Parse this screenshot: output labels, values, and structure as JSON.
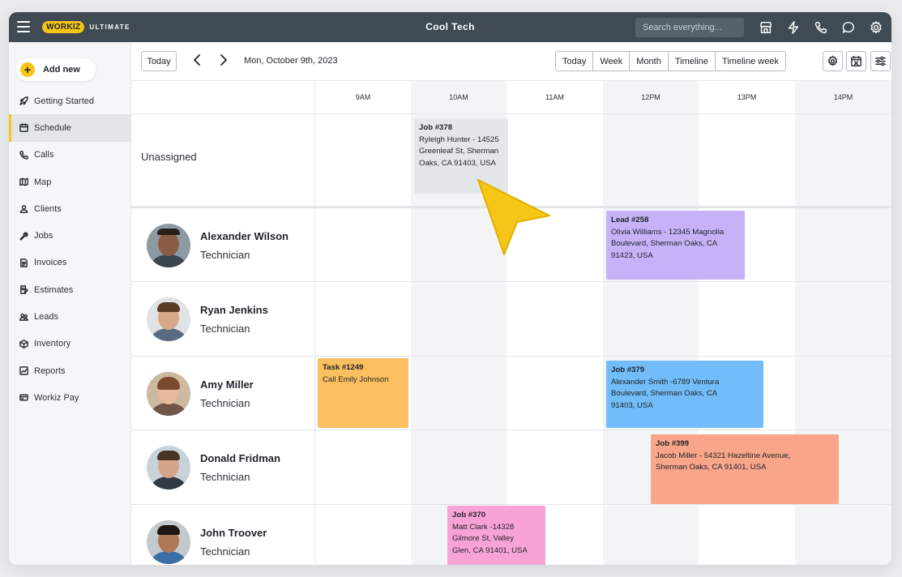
{
  "app": {
    "logo": "WORKIZ",
    "tier": "ULTIMATE",
    "company": "Cool Tech",
    "search_placeholder": "Search everything..."
  },
  "topbar_icons": [
    "store-icon",
    "lightning-icon",
    "phone-icon",
    "chat-icon",
    "gear-icon"
  ],
  "sidebar": {
    "add_new": "Add new",
    "items": [
      {
        "label": "Getting Started",
        "icon": "rocket-icon"
      },
      {
        "label": "Schedule",
        "icon": "calendar-icon",
        "active": true
      },
      {
        "label": "Calls",
        "icon": "phone-icon"
      },
      {
        "label": "Map",
        "icon": "map-icon"
      },
      {
        "label": "Clients",
        "icon": "clients-icon"
      },
      {
        "label": "Jobs",
        "icon": "wrench-icon"
      },
      {
        "label": "Invoices",
        "icon": "invoice-icon"
      },
      {
        "label": "Estimates",
        "icon": "estimate-icon"
      },
      {
        "label": "Leads",
        "icon": "leads-icon"
      },
      {
        "label": "Inventory",
        "icon": "box-icon"
      },
      {
        "label": "Reports",
        "icon": "reports-icon"
      },
      {
        "label": "Workiz Pay",
        "icon": "card-icon"
      }
    ]
  },
  "toolbar": {
    "today": "Today",
    "date": "Mon, October  9th, 2023",
    "views": [
      "Today",
      "Week",
      "Month",
      "Timeline",
      "Timeline week"
    ]
  },
  "schedule": {
    "hours": [
      "9AM",
      "10AM",
      "11AM",
      "12PM",
      "13PM",
      "14PM"
    ],
    "unassigned_label": "Unassigned",
    "technicians": [
      {
        "name": "Alexander Wilson",
        "role": "Technician"
      },
      {
        "name": "Ryan Jenkins",
        "role": "Technician"
      },
      {
        "name": "Amy Miller",
        "role": "Technician"
      },
      {
        "name": "Donald Fridman",
        "role": "Technician"
      },
      {
        "name": "John Troover",
        "role": "Technician"
      }
    ],
    "events": [
      {
        "title": "Job #378",
        "lines": [
          "Ryleigh Hunter - 14525",
          "Greenleaf St, Sherman",
          "Oaks,  CA 91403, USA"
        ],
        "color": "#e4e7ea"
      },
      {
        "title": "Lead #258",
        "lines": [
          "Olivia Williams - 12345 Magnolia",
          "Boulevard, Sherman Oaks, CA",
          "91423, USA"
        ],
        "color": "#c7b2f7"
      },
      {
        "title": "Task #1249",
        "lines": [
          "Call Emily Johnson"
        ],
        "color": "#fbbf60"
      },
      {
        "title": "Job #379",
        "lines": [
          "Alexander Smith -6789 Ventura",
          "Boulevard, Sherman Oaks, CA",
          "91403, USA"
        ],
        "color": "#72bcf9"
      },
      {
        "title": "Job #399",
        "lines": [
          "Jacob Miller - 54321 Hazeltine Avenue,",
          "Sherman Oaks, CA 91401, USA"
        ],
        "color": "#f8a58a"
      },
      {
        "title": "Job #370",
        "lines": [
          "Matt Clark -14328",
          "Gilmore St, Valley",
          "Glen, CA 91401, USA"
        ],
        "color": "#f8a3d6"
      }
    ]
  },
  "colors": {
    "topbar": "#3f4a53",
    "accent": "#f5c518",
    "cursor": "#f5c518"
  }
}
